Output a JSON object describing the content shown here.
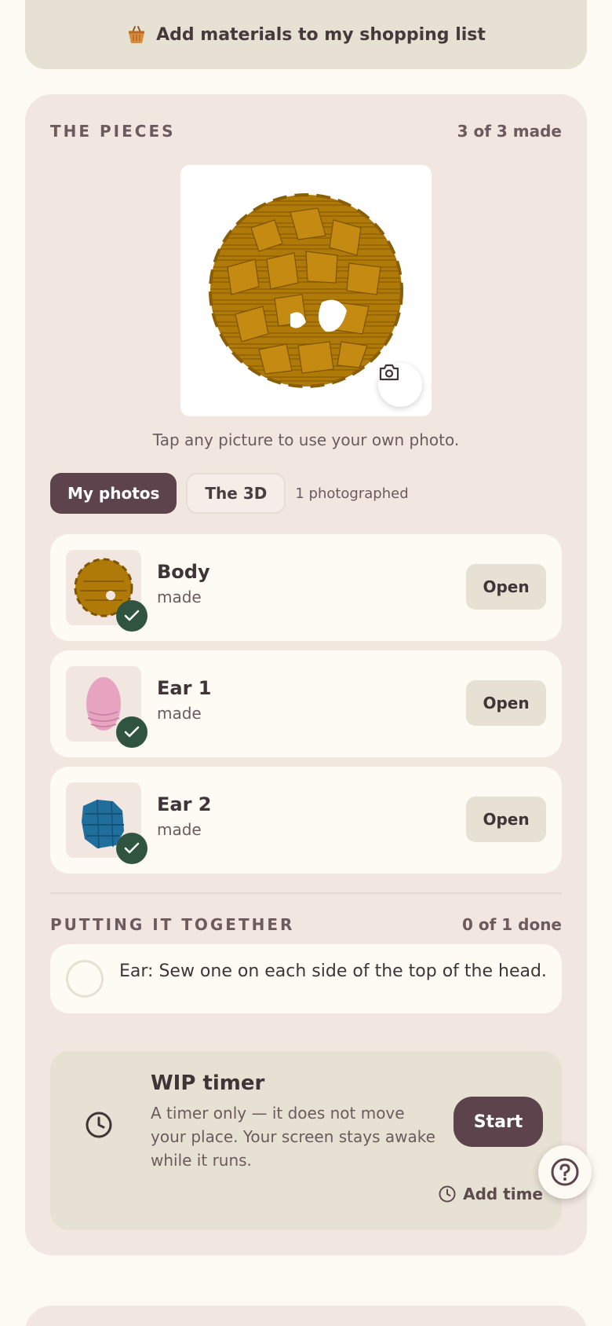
{
  "shopping": {
    "label": "Add materials to my shopping list",
    "icon": "basket-icon"
  },
  "pieces_section": {
    "title": "THE PIECES",
    "count": "3 of 3 made",
    "hint": "Tap any picture to use your own photo.",
    "tabs": [
      {
        "label": "My photos",
        "active": true
      },
      {
        "label": "The 3D",
        "active": false
      }
    ],
    "tab_note": "1 photographed",
    "items": [
      {
        "name": "Body",
        "status": "made",
        "open_label": "Open",
        "color": "#b07a08"
      },
      {
        "name": "Ear 1",
        "status": "made",
        "open_label": "Open",
        "color": "#e6a4c0"
      },
      {
        "name": "Ear 2",
        "status": "made",
        "open_label": "Open",
        "color": "#1f6e9c"
      }
    ]
  },
  "assembly": {
    "title": "PUTTING IT TOGETHER",
    "count": "0 of 1 done",
    "steps": [
      {
        "text": "Ear: Sew one on each side of the top of the head."
      }
    ]
  },
  "timer": {
    "title": "WIP timer",
    "description": "A timer only — it does not move your place. Your screen stays awake while it runs.",
    "start_label": "Start",
    "add_time_label": "Add time"
  },
  "colors": {
    "accent": "#5d434c",
    "card": "#f2e6e1",
    "check": "#2f5440",
    "button": "#e6e1d2"
  }
}
